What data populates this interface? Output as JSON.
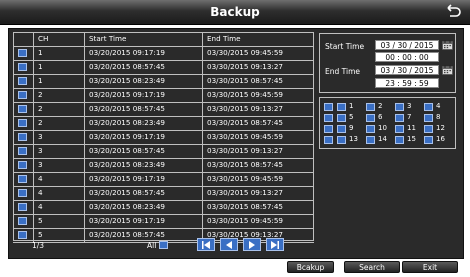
{
  "title": "Backup",
  "columns": [
    "CH",
    "Start Time",
    "End Time"
  ],
  "rows": [
    {
      "ch": "1",
      "start": "03/20/2015  09:17:19",
      "end": "03/30/2015  09:45:59"
    },
    {
      "ch": "1",
      "start": "03/20/2015  08:57:45",
      "end": "03/30/2015  09:13:27"
    },
    {
      "ch": "1",
      "start": "03/20/2015  08:23:49",
      "end": "03/30/2015  08:57:45"
    },
    {
      "ch": "2",
      "start": "03/20/2015  09:17:19",
      "end": "03/30/2015  09:45:59"
    },
    {
      "ch": "2",
      "start": "03/20/2015  08:57:45",
      "end": "03/30/2015  09:13:27"
    },
    {
      "ch": "2",
      "start": "03/20/2015  08:23:49",
      "end": "03/30/2015  08:57:45"
    },
    {
      "ch": "3",
      "start": "03/20/2015  09:17:19",
      "end": "03/30/2015  09:45:59"
    },
    {
      "ch": "3",
      "start": "03/20/2015  08:57:45",
      "end": "03/30/2015  09:13:27"
    },
    {
      "ch": "3",
      "start": "03/20/2015  08:23:49",
      "end": "03/30/2015  08:57:45"
    },
    {
      "ch": "4",
      "start": "03/20/2015  09:17:19",
      "end": "03/30/2015  09:45:59"
    },
    {
      "ch": "4",
      "start": "03/20/2015  08:57:45",
      "end": "03/30/2015  09:13:27"
    },
    {
      "ch": "4",
      "start": "03/20/2015  08:23:49",
      "end": "03/30/2015  08:57:45"
    },
    {
      "ch": "5",
      "start": "03/20/2015  09:17:19",
      "end": "03/30/2015  09:45:59"
    },
    {
      "ch": "5",
      "start": "03/20/2015  08:57:45",
      "end": "03/30/2015  09:13:27"
    }
  ],
  "pager": {
    "page": "1/3",
    "all_label": "All"
  },
  "time_panel": {
    "start_label": "Start Time",
    "start_date": "03 / 30 / 2015",
    "start_time": "00 : 00 : 00",
    "end_label": "End Time",
    "end_date": "03 / 30 / 2015",
    "end_time": "23 : 59 : 59"
  },
  "channels": [
    "1",
    "2",
    "3",
    "4",
    "5",
    "6",
    "7",
    "8",
    "9",
    "10",
    "11",
    "12",
    "13",
    "14",
    "15",
    "16"
  ],
  "buttons": {
    "backup": "Bcakup",
    "search": "Search",
    "exit": "Exit"
  },
  "colors": {
    "accent": "#3a6fc4",
    "panel": "#2a2a2a",
    "titlebar": "#1b1b1b"
  }
}
